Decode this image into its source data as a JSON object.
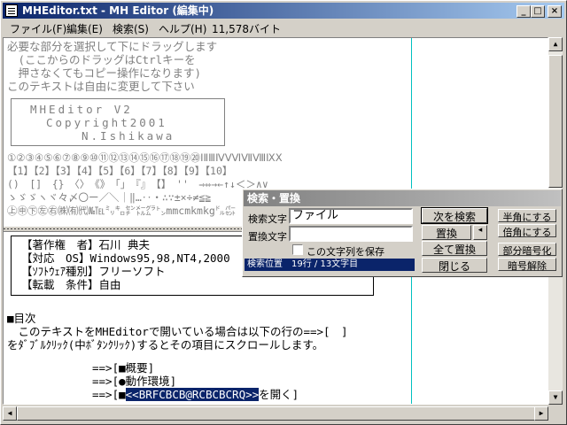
{
  "window": {
    "title": "MHEditor.txt - MH Editor (編集中)",
    "min_glyph": "_",
    "max_glyph": "□",
    "close_glyph": "×"
  },
  "menu": {
    "file": "ファイル(F)",
    "edit": "編集(E)",
    "search": "検索(S)",
    "help": "ヘルプ(H)",
    "size": "11,578バイト"
  },
  "editor": {
    "lines_top": [
      "必要な部分を選択して下にドラッグします",
      "　(ここからのドラッグはCtrlキーを",
      "　押さなくてもコピー操作になります)",
      "このテキストは自由に変更して下さい"
    ],
    "logo_lines": [
      "MHEditor V2",
      "Copyright2001",
      "N.Ishikawa"
    ],
    "symbol_lines": [
      "①②③④⑤⑥⑦⑧⑨⑩⑪⑫⑬⑭⑮⑯⑰⑱⑲⑳ⅠⅡⅢⅣⅤⅥⅦⅧⅨⅩ",
      "【1】【2】【3】【4】【5】【6】【7】【8】【9】【10】",
      "()　[]　{}　〈〉　《》　「」　『』　【】　''　⇒⇔→←↑↓＜＞∧∨",
      "ゝゞゞヽヾ々〆〇ー／＼｜‖…‥・∴∵±×÷≠≦≧",
      "㊤㊥㊦㊧㊨㈱㈲㈹№℡㍉㌔㌢㍍㌘㌧mmcmkmkg㌦㌫"
    ],
    "info_lines": [
      "【著作権　者】石川 典夫",
      "【対応　OS】Windows95,98,NT4,2000",
      "【ｿﾌﾄｳｪｱ種別】フリーソフト",
      "【転載　条件】自由"
    ],
    "toc_heading": "■目次",
    "toc_desc_1": "　このテキストをMHEditorで開いている場合は以下の行の==>[　]",
    "toc_desc_2": "をﾀﾞﾌﾞﾙｸﾘｯｸ(中ﾎﾞﾀﾝｸﾘｯｸ)するとその項目にスクロールします。",
    "toc_1": "==>[■概要]",
    "toc_2": "==>[●動作環境]",
    "toc_3_prefix": "==>[■",
    "toc_3_highlight": "<<BRFCBCB@RCBCBCRQ>>",
    "toc_3_suffix": "を開く]"
  },
  "dialog": {
    "title": "検索・置換",
    "search_label": "検索文字",
    "search_value": "ファイル",
    "replace_label": "置換文字",
    "replace_value": "",
    "save_checkbox_label": "この文字列を保存",
    "save_checked": false,
    "status": "検索位置　19行 / 13文字目",
    "btn_find_next": "次を検索",
    "btn_replace": "置換",
    "btn_replace_arrow": "◂",
    "btn_replace_all": "全て置換",
    "btn_close": "閉じる",
    "btn_half": "半角にする",
    "btn_full": "倍角にする",
    "btn_encrypt": "部分暗号化",
    "btn_decrypt": "暗号解除"
  }
}
